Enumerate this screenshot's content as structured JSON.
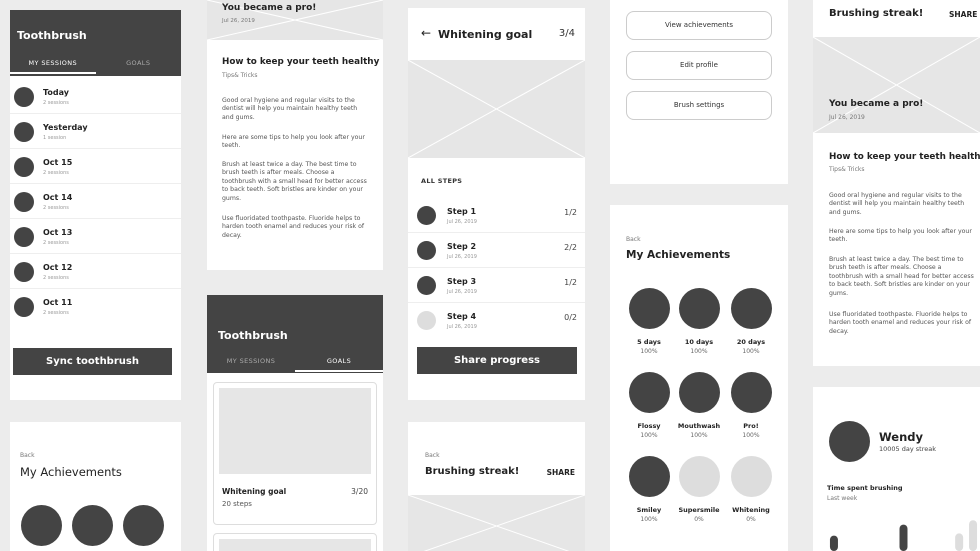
{
  "col1": {
    "header_title": "Toothbrush",
    "tabs": [
      "MY SESSIONS",
      "GOALS"
    ],
    "sessions": [
      {
        "day": "Today",
        "count": "2 sessions"
      },
      {
        "day": "Yesterday",
        "count": "1 session"
      },
      {
        "day": "Oct 15",
        "count": "2 sessions"
      },
      {
        "day": "Oct 14",
        "count": "2 sessions"
      },
      {
        "day": "Oct 13",
        "count": "2 sessions"
      },
      {
        "day": "Oct 12",
        "count": "2 sessions"
      },
      {
        "day": "Oct 11",
        "count": "2 sessions"
      }
    ],
    "sync_button": "Sync toothbrush",
    "ach_back": "Back",
    "ach_title": "My Achievements"
  },
  "col2": {
    "top_title": "You became a pro!",
    "top_date": "Jul 26, 2019",
    "article_title": "How to keep your teeth healthy",
    "article_sub": "Tips& Tricks",
    "paragraphs": [
      "Good oral hygiene and regular visits to the dentist will help you maintain healthy teeth and gums.",
      "Here are some tips to help you look after your teeth.",
      "Brush at least twice a day. The best time to brush teeth is after meals. Choose a toothbrush with a small head for better access to back teeth. Soft bristles are kinder on your gums.",
      "Use fluoridated toothpaste. Fluoride helps to harden tooth enamel and reduces your risk of decay."
    ],
    "header_title": "Toothbrush",
    "tabs": [
      "MY SESSIONS",
      "GOALS"
    ],
    "goal_name": "Whitening goal",
    "goal_progress": "3/20",
    "goal_steps": "20 steps"
  },
  "col3": {
    "title": "Whitening goal",
    "progress": "3/4",
    "back_arrow": "←",
    "steps_label": "ALL STEPS",
    "steps": [
      {
        "name": "Step 1",
        "date": "Jul 26, 2019",
        "count": "1/2"
      },
      {
        "name": "Step 2",
        "date": "Jul 26, 2019",
        "count": "2/2"
      },
      {
        "name": "Step 3",
        "date": "Jul 26, 2019",
        "count": "1/2"
      },
      {
        "name": "Step 4",
        "date": "Jul 26, 2019",
        "count": "0/2"
      }
    ],
    "share_button": "Share progress",
    "streak_back": "Back",
    "streak_title": "Brushing streak!",
    "streak_share": "SHARE"
  },
  "col4": {
    "buttons": [
      "View achievements",
      "Edit profile",
      "Brush settings"
    ],
    "back": "Back",
    "title": "My Achievements",
    "achievements": [
      {
        "name": "5 days",
        "pct": "100%"
      },
      {
        "name": "10 days",
        "pct": "100%"
      },
      {
        "name": "20 days",
        "pct": "100%"
      },
      {
        "name": "Flossy",
        "pct": "100%"
      },
      {
        "name": "Mouthwash",
        "pct": "100%"
      },
      {
        "name": "Pro!",
        "pct": "100%"
      },
      {
        "name": "Smiley",
        "pct": "100%"
      },
      {
        "name": "Supersmile",
        "pct": "0%"
      },
      {
        "name": "Whitening",
        "pct": "0%"
      }
    ]
  },
  "col5": {
    "streak_title": "Brushing streak!",
    "share": "SHARE",
    "pro_title": "You became a pro!",
    "pro_date": "Jul 26, 2019",
    "article_title": "How to keep your teeth healthy",
    "article_sub": "Tips& Tricks",
    "paragraphs": [
      "Good oral hygiene and regular visits to the dentist will help you maintain healthy teeth and gums.",
      "Here are some tips to help you look after your teeth.",
      "Brush at least twice a day. The best time to brush teeth is after meals. Choose a toothbrush with a small head for better access to back teeth. Soft bristles are kinder on your gums.",
      "Use fluoridated toothpaste. Fluoride helps to harden tooth enamel and reduces your risk of decay."
    ],
    "profile_name": "Wendy",
    "profile_streak": "10005 day streak",
    "time_title": "Time spent brushing",
    "time_sub": "Last week",
    "bars": [
      {
        "level": 0.35,
        "color": "#444"
      },
      {
        "level": 0.0,
        "color": "#444"
      },
      {
        "level": 0.0,
        "color": "#444"
      },
      {
        "level": 0.0,
        "color": "#444"
      },
      {
        "level": 0.0,
        "color": "#444"
      },
      {
        "level": 0.6,
        "color": "#444"
      },
      {
        "level": 0.0,
        "color": "#444"
      },
      {
        "level": 0.0,
        "color": "#444"
      },
      {
        "level": 0.0,
        "color": "#444"
      },
      {
        "level": 0.4,
        "color": "#ddd"
      },
      {
        "level": 0.7,
        "color": "#ddd"
      }
    ]
  }
}
